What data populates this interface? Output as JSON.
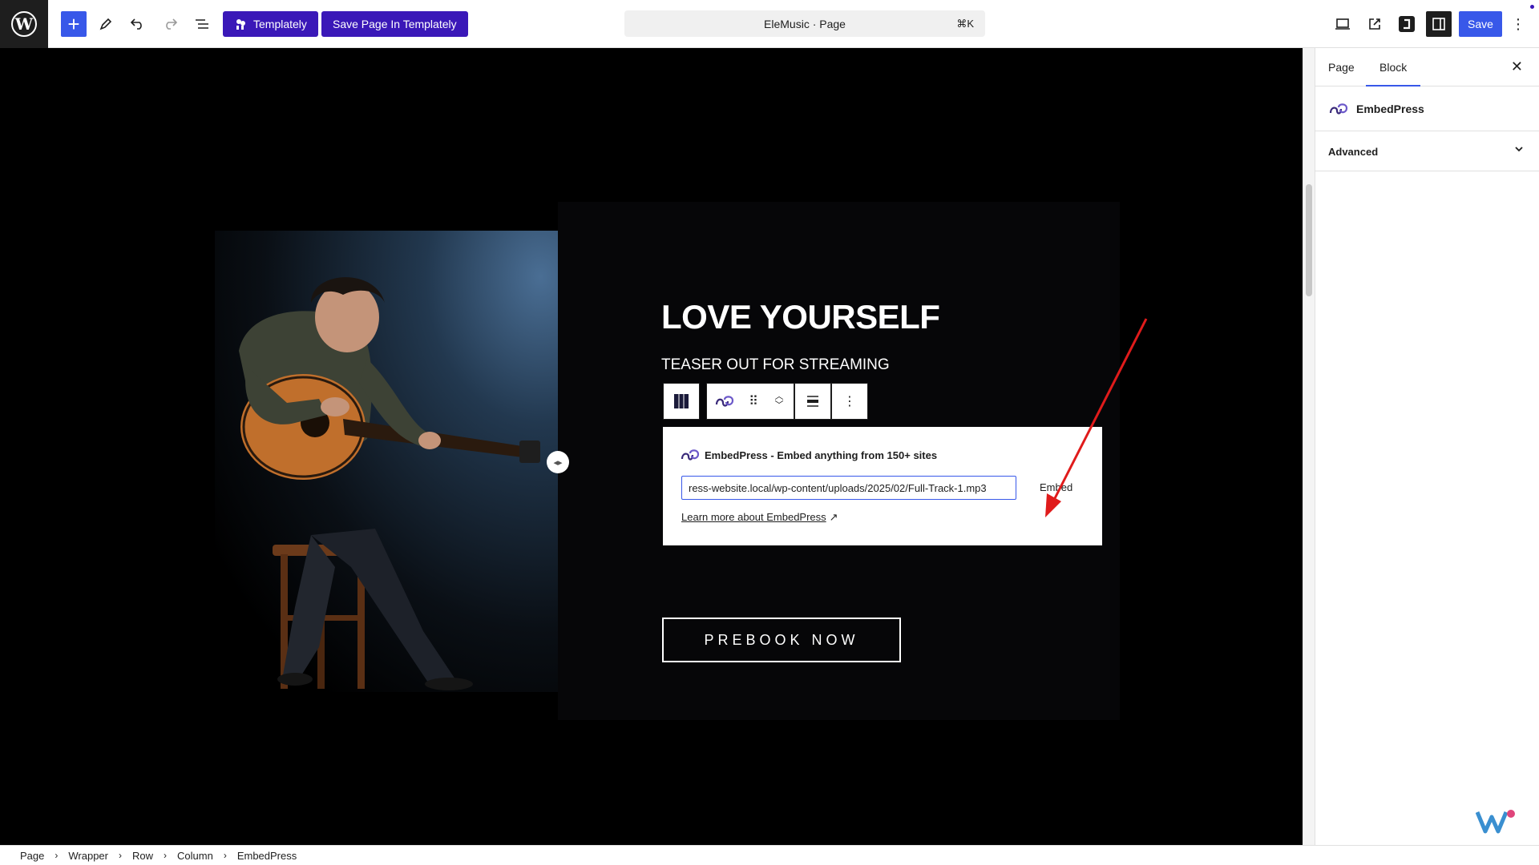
{
  "topbar": {
    "templately_label": "Templately",
    "save_templately_label": "Save Page In Templately",
    "doc_title": "EleMusic · Page",
    "shortcut": "⌘K",
    "save_label": "Save"
  },
  "canvas": {
    "headline": "LOVE YOURSELF",
    "subhead": "TEASER OUT FOR STREAMING",
    "embed": {
      "title": "EmbedPress - Embed anything from 150+ sites",
      "url_value": "ress-website.local/wp-content/uploads/2025/02/Full-Track-1.mp3",
      "embed_button": "Embed",
      "learn_more": "Learn more about EmbedPress",
      "external_glyph": "↗"
    },
    "cta": "PREBOOK NOW"
  },
  "sidebar": {
    "tabs": [
      "Page",
      "Block"
    ],
    "active_tab": "Block",
    "block_name": "EmbedPress",
    "panel": "Advanced"
  },
  "breadcrumb": [
    "Page",
    "Wrapper",
    "Row",
    "Column",
    "EmbedPress"
  ],
  "colors": {
    "accent": "#3858e9",
    "templately": "#3a18b8",
    "annotation_arrow": "#e01b1b"
  }
}
